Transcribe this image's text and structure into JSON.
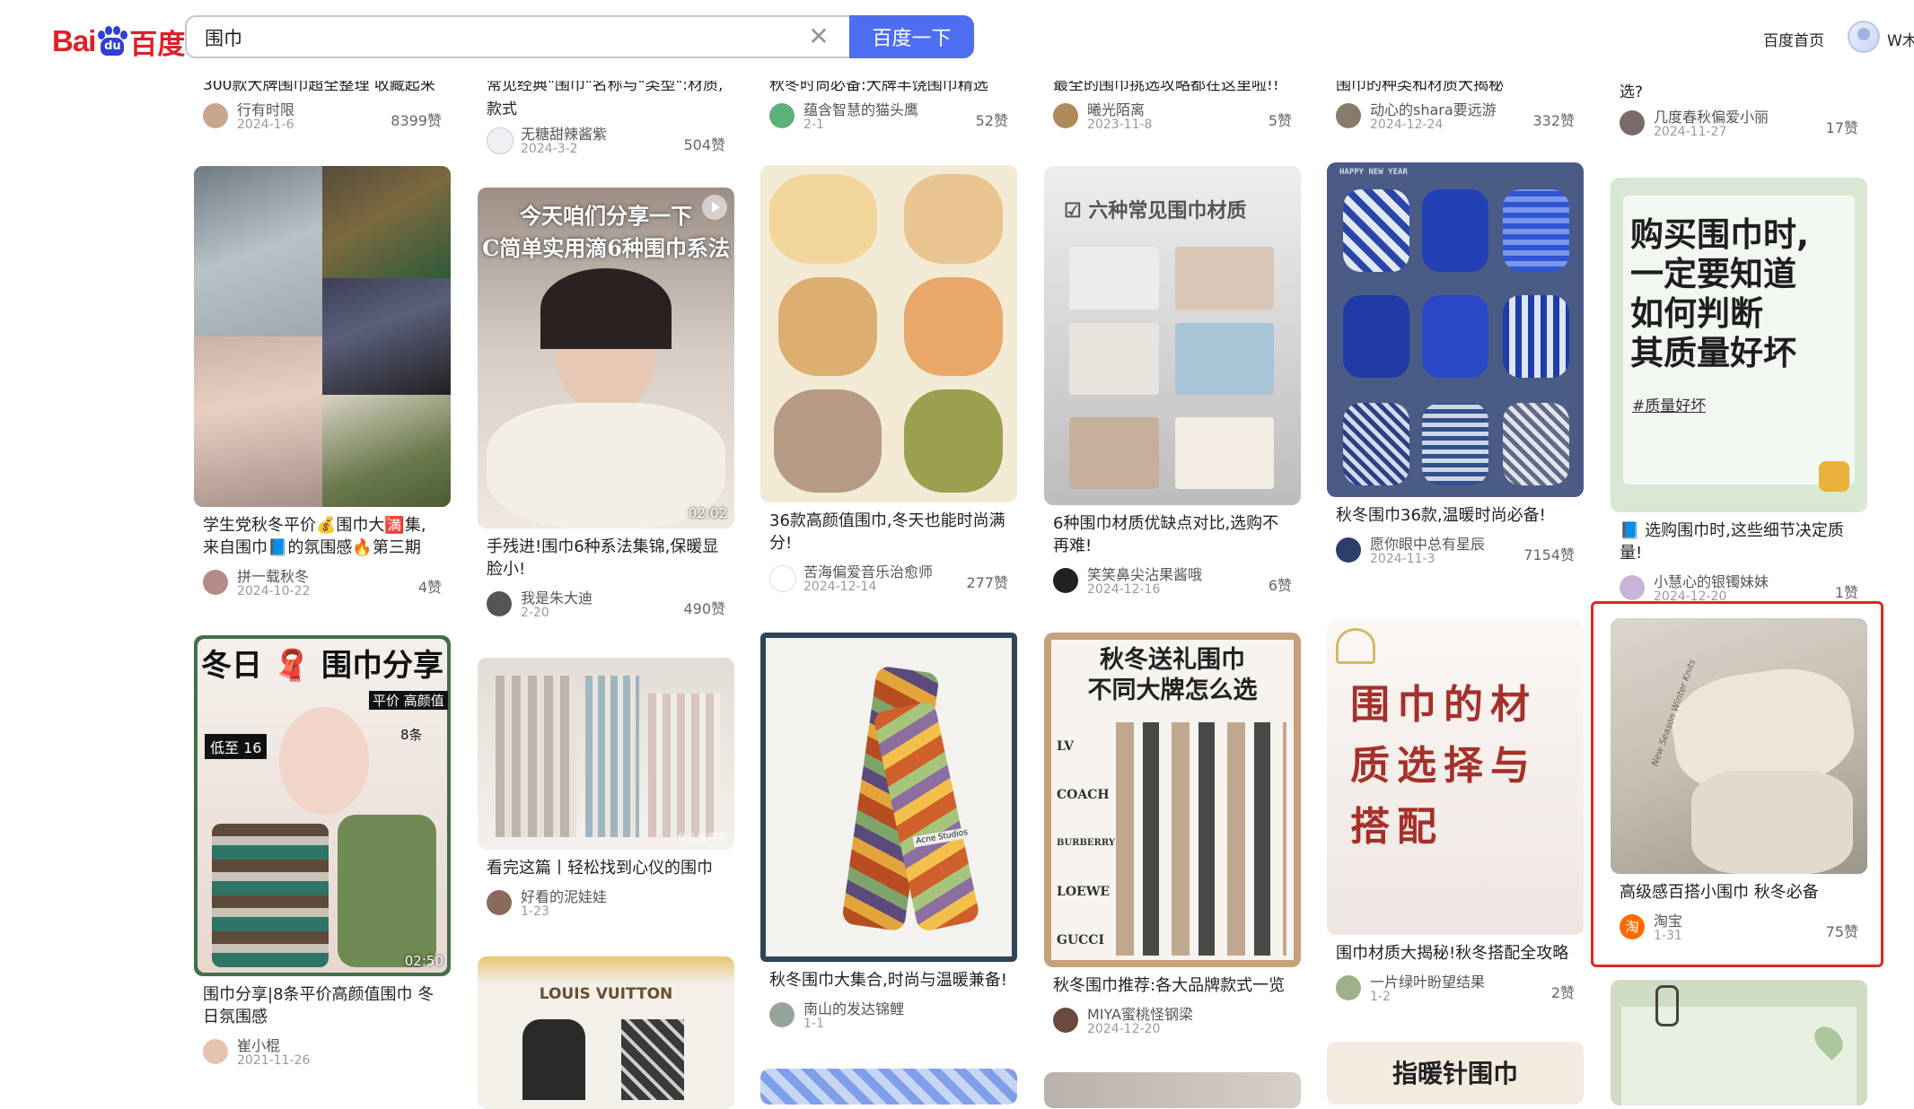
{
  "header": {
    "logo_bai": "Bai",
    "logo_du": "百度",
    "logo_paw_text": "du",
    "search_value": "围巾",
    "search_button": "百度一下",
    "home_link": "百度首页",
    "user_name": "W木"
  },
  "top_row": [
    {
      "title_tail": "300款大牌围巾超全整理 收藏起来",
      "author": "行有时限",
      "date": "2024-1-6",
      "likes": "8399赞"
    },
    {
      "title_tail": "常见经典\"围巾\"名称与\"类型\":材质,",
      "title_tail2": "款式",
      "author": "无糖甜辣酱紫",
      "date": "2024-3-2",
      "likes": "504赞"
    },
    {
      "title_tail": "秋冬时尚必备:大牌丰饶围巾精选",
      "author": "蕴含智慧的猫头鹰",
      "date": "2-1",
      "likes": "52赞"
    },
    {
      "title_tail": "最全的围巾挑选攻略都在这里啦!!",
      "author": "曦光陌离",
      "date": "2023-11-8",
      "likes": "5赞"
    },
    {
      "title_tail": "围巾的种类和材质大揭秘",
      "author": "动心的shara要远游",
      "date": "2024-12-24",
      "likes": "332赞"
    },
    {
      "title_tail": "选?",
      "author": "几度春秋偏爱小丽",
      "date": "2024-11-27",
      "likes": "17赞"
    }
  ],
  "cards": [
    {
      "title": "学生党秋冬平价💰围巾大🈵集,来自围巾📘的氛围感🔥第三期",
      "author": "拼一载秋冬",
      "date": "2024-10-22",
      "likes": "4赞"
    },
    {
      "title": "手残进!围巾6种系法集锦,保暖显脸小!",
      "author": "我是朱大迪",
      "date": "2-20",
      "likes": "490赞",
      "overlay": "今天咱们分享一下\nC简单实用滴6种围巾系法",
      "duration": "02:02"
    },
    {
      "title": "36款高颜值围巾,冬天也能时尚满分!",
      "author": "苦海偏爱音乐治愈师",
      "date": "2024-12-14",
      "likes": "277赞"
    },
    {
      "title": "6种围巾材质优缺点对比,选购不再难!",
      "author": "笑笑鼻尖沾果酱哦",
      "date": "2024-12-16",
      "likes": "6赞",
      "overlay": "☑ 六种常见围巾材质"
    },
    {
      "title": "秋冬围巾36款,温暖时尚必备!",
      "author": "愿你眼中总有星辰",
      "date": "2024-11-3",
      "likes": "7154赞",
      "overlay": "HAPPY NEW YEAR"
    },
    {
      "title": "📘 选购围巾时,这些细节决定质量!",
      "author": "小慧心的银镯妹妹",
      "date": "2024-12-20",
      "likes": "1赞",
      "overlay": "购买围巾时,\n一定要知道\n如何判断\n其质量好坏",
      "tag": "#质量好坏"
    },
    {
      "title": "围巾分享|8条平价高颜值围巾 冬日氛围感",
      "author": "崔小棍",
      "date": "2021-11-26",
      "likes": "",
      "overlay": "冬日 🧣 围巾分享",
      "sub1": "平价 高颜值",
      "sub2": "8条",
      "sub3": "低至 16",
      "duration": "02:50"
    },
    {
      "title": "看完这篇丨轻松找到心仪的围巾",
      "author": "好看的泥娃娃",
      "date": "1-23",
      "likes": "",
      "watermark": "什么值得买"
    },
    {
      "title": "秋冬围巾大集合,时尚与温暖兼备!",
      "author": "南山的发达锦鲤",
      "date": "1-1",
      "likes": "",
      "tag_text": "Acne Studios"
    },
    {
      "title": "秋冬围巾推荐:各大品牌款式一览",
      "author": "MIYA蜜桃怪钢梁",
      "date": "2024-12-20",
      "likes": "",
      "overlay": "秋冬送礼围巾\n不同大牌怎么选",
      "brands": [
        "LV",
        "COACH",
        "BURBERRY",
        "LOEWE",
        "GUCCI"
      ]
    },
    {
      "title": "围巾材质大揭秘!秋冬搭配全攻略",
      "author": "一片绿叶盼望结果",
      "date": "1-2",
      "likes": "2赞",
      "overlay": "围巾的材\n质选择与\n搭配"
    },
    {
      "title": "高级感百搭小围巾 秋冬必备",
      "author": "淘宝",
      "date": "1-31",
      "likes": "75赞",
      "script_text": "New Season Winter Knits"
    }
  ],
  "bottom_row": [
    {
      "overlay": "LOUIS VUITTON"
    },
    {
      "overlay": ""
    },
    {
      "overlay": ""
    },
    {
      "overlay": "指暖针围巾"
    },
    {
      "overlay": ""
    }
  ]
}
